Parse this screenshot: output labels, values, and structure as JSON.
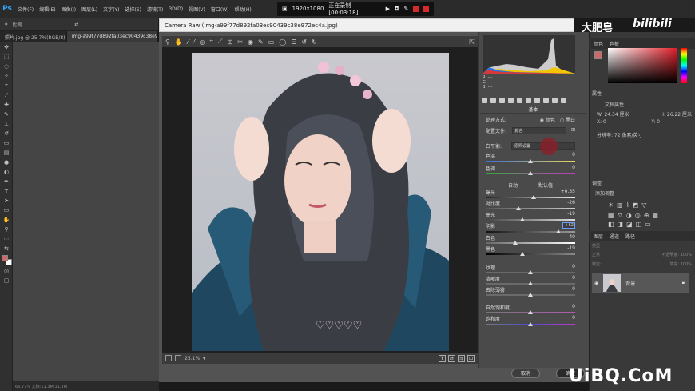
{
  "menubar": {
    "logo": "Ps",
    "items": [
      "文件(F)",
      "编辑(E)",
      "图像(I)",
      "图层(L)",
      "文字(Y)",
      "选择(S)",
      "滤镜(T)",
      "3D(D)",
      "视图(V)",
      "窗口(W)",
      "帮助(H)"
    ]
  },
  "recorder": {
    "resolution": "1920x1080",
    "status": "正在录制 [00:03:18]"
  },
  "options_bar": {
    "ratio": "比例"
  },
  "doc_tabs": [
    "照片.jpg @ 25.7%(RGB/8)",
    "img-a99f77d892fa03ec90439c38e9"
  ],
  "status_left": "66.77% 文档:11.3M/11.3M",
  "camera_raw": {
    "title": "Camera Raw (img-a99f77d892fa03ec90439c38e972ec4a.jpg)",
    "zoom_value": "25.1%",
    "panel_title": "基本",
    "process_label": "处理方式:",
    "color_option": "颜色",
    "bw_option": "黑白",
    "profile_label": "配置文件:",
    "profile_value": "颜色",
    "wb_label": "白平衡:",
    "wb_value": "原照设置",
    "temp_label": "色温",
    "temp_value": "0",
    "tint_label": "色调",
    "tint_value": "0",
    "auto_label": "自动",
    "default_label": "默认值",
    "sliders": [
      {
        "label": "曝光",
        "value": "+0.35"
      },
      {
        "label": "对比度",
        "value": "-26"
      },
      {
        "label": "高光",
        "value": "-19"
      },
      {
        "label": "阴影",
        "value": "+62"
      },
      {
        "label": "白色",
        "value": "-40"
      },
      {
        "label": "黑色",
        "value": "-19"
      }
    ],
    "presence": [
      {
        "label": "纹理",
        "value": "0"
      },
      {
        "label": "清晰度",
        "value": "0"
      },
      {
        "label": "去除薄雾",
        "value": "0"
      },
      {
        "label": "自然饱和度",
        "value": "0"
      },
      {
        "label": "饱和度",
        "value": "0"
      }
    ],
    "cancel": "取消",
    "ok": "确定",
    "tab_icons": [
      "basic",
      "curve",
      "detail",
      "hsl",
      "split-tone",
      "lens",
      "effects",
      "calibration",
      "presets",
      "snapshots"
    ]
  },
  "ps_panels": {
    "color_tabs": [
      "颜色",
      "色板"
    ],
    "props_title": "属性",
    "props_sub": "文档属性",
    "props_w": "W: 24.34 厘米",
    "props_h": "H: 26.22 厘米",
    "props_x": "X: 0",
    "props_y": "Y: 0",
    "props_res": "分辨率: 72 像素/英寸",
    "adjust_title": "调整",
    "adjust_sub": "添加调整",
    "layers_tabs": [
      "图层",
      "通道",
      "路径"
    ],
    "layers_kind": "类型",
    "layers_mode": "正常",
    "layers_opacity": "不透明度: 100%",
    "layers_lock": "锁定:",
    "layers_fill": "填充: 100%",
    "layer_name": "背景"
  },
  "watermarks": {
    "channel": "大肥皂",
    "bili": "bilibili",
    "site": "UiBQ.CoM"
  },
  "colors": {
    "accent": "#31a8ff",
    "record": "#d52b2b",
    "fg_swatch": "#c96a6a"
  }
}
